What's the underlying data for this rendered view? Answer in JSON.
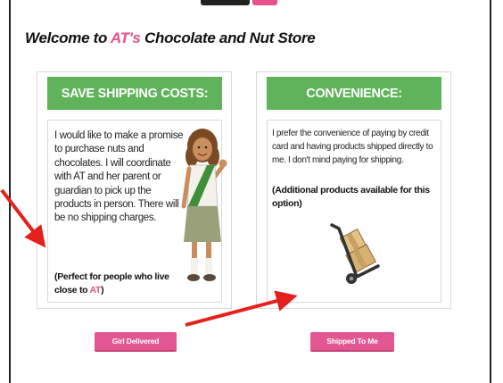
{
  "welcome": {
    "prefix": "Welcome to ",
    "brand": "AT's",
    "suffix": " Chocolate and Nut Store"
  },
  "options": {
    "left": {
      "header": "SAVE SHIPPING COSTS:",
      "description": "I would like to make a promise to purchase nuts and chocolates. I will coordinate with AT and her parent or guardian to pick up the products in person. There will be no shipping charges.",
      "note_prefix": "(Perfect for people who live close to ",
      "note_brand": "AT",
      "note_suffix": ")",
      "button_label": "Girl Delivered",
      "illustration_icon": "girl-scout-icon"
    },
    "right": {
      "header": "CONVENIENCE:",
      "description": "I prefer the convenience of paying by credit card and having products shipped directly to me. I don't mind paying for shipping.",
      "note": "(Additional products available for this option)",
      "button_label": "Shipped To Me",
      "illustration_icon": "hand-truck-boxes-icon"
    }
  },
  "colors": {
    "header_green": "#5fb35a",
    "brand_pink": "#e6508c",
    "annotation_arrow": "#e3201b"
  }
}
